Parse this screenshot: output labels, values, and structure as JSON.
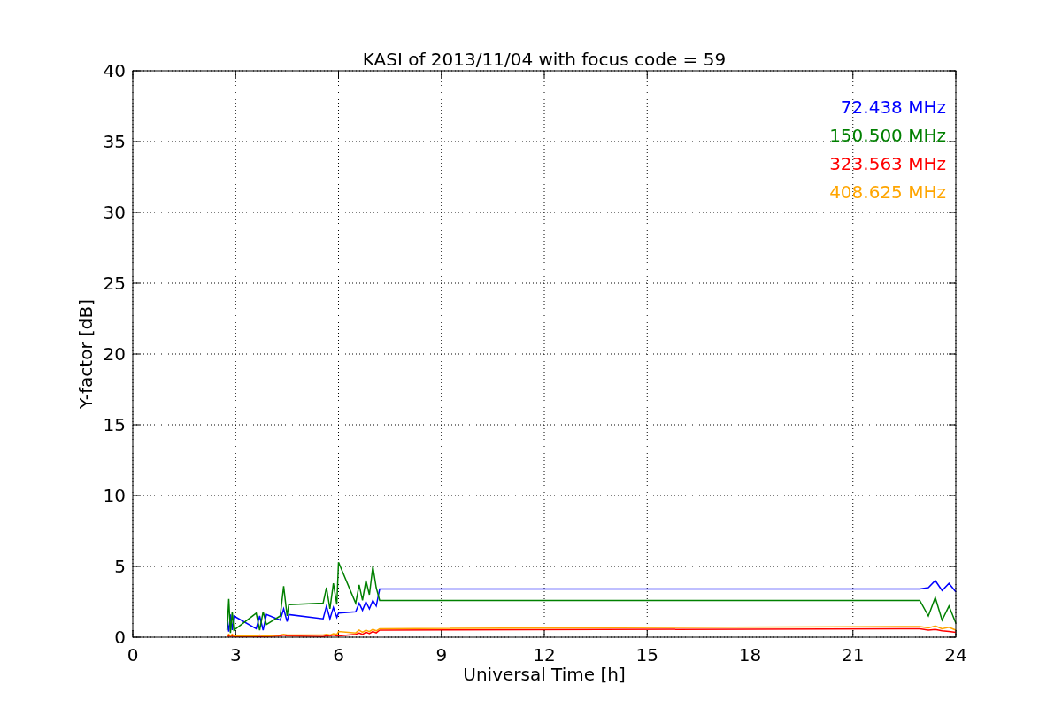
{
  "chart_data": {
    "type": "line",
    "title": "KASI of 2013/11/04 with focus code = 59",
    "xlabel": "Universal Time [h]",
    "ylabel": "Y-factor [dB]",
    "grid": true,
    "x": [
      2.75,
      2.8,
      2.85,
      2.9,
      2.95,
      3.6,
      3.7,
      3.8,
      3.9,
      4.3,
      4.4,
      4.5,
      4.55,
      5.55,
      5.65,
      5.75,
      5.85,
      5.95,
      6.0,
      6.5,
      6.6,
      6.7,
      6.8,
      6.9,
      7.0,
      7.1,
      7.2,
      22.95,
      23.2,
      23.4,
      23.6,
      23.8,
      24.0
    ],
    "series": [
      {
        "name": "72.438 MHz",
        "color": "#0000ff",
        "values": [
          1.2,
          0.4,
          1.6,
          0.5,
          1.5,
          0.6,
          1.5,
          0.5,
          1.6,
          1.2,
          2.0,
          1.1,
          1.6,
          1.3,
          2.2,
          1.3,
          2.1,
          1.4,
          1.7,
          1.8,
          2.4,
          1.9,
          2.5,
          2.0,
          2.6,
          2.2,
          3.4,
          3.4,
          3.5,
          4.0,
          3.3,
          3.8,
          3.2
        ]
      },
      {
        "name": "150.500 MHz",
        "color": "#008000",
        "values": [
          0.5,
          2.7,
          0.3,
          1.8,
          0.5,
          1.7,
          0.5,
          1.8,
          0.9,
          1.5,
          3.6,
          1.5,
          2.3,
          2.4,
          3.5,
          2.0,
          3.8,
          2.3,
          5.3,
          2.4,
          3.7,
          2.6,
          4.0,
          3.0,
          5.0,
          3.5,
          2.6,
          2.6,
          1.5,
          2.8,
          1.2,
          2.2,
          1.0
        ]
      },
      {
        "name": "323.563 MHz",
        "color": "#ff0000",
        "values": [
          0.05,
          0.1,
          0.05,
          0.1,
          0.05,
          0.05,
          0.05,
          0.05,
          0.05,
          0.1,
          0.15,
          0.1,
          0.1,
          0.05,
          0.1,
          0.1,
          0.15,
          0.1,
          0.1,
          0.2,
          0.3,
          0.2,
          0.35,
          0.25,
          0.4,
          0.3,
          0.5,
          0.6,
          0.5,
          0.55,
          0.45,
          0.4,
          0.35
        ]
      },
      {
        "name": "408.625 MHz",
        "color": "#ffa500",
        "values": [
          0.1,
          0.2,
          0.1,
          0.2,
          0.1,
          0.1,
          0.15,
          0.1,
          0.1,
          0.15,
          0.2,
          0.15,
          0.15,
          0.15,
          0.2,
          0.15,
          0.25,
          0.2,
          0.4,
          0.3,
          0.5,
          0.35,
          0.5,
          0.4,
          0.55,
          0.45,
          0.6,
          0.75,
          0.65,
          0.8,
          0.6,
          0.7,
          0.5
        ]
      }
    ],
    "xlim": [
      0,
      24
    ],
    "ylim": [
      0,
      40
    ],
    "xticks": [
      0,
      3,
      6,
      9,
      12,
      15,
      18,
      21,
      24
    ],
    "yticks": [
      0,
      5,
      10,
      15,
      20,
      25,
      30,
      35,
      40
    ]
  }
}
